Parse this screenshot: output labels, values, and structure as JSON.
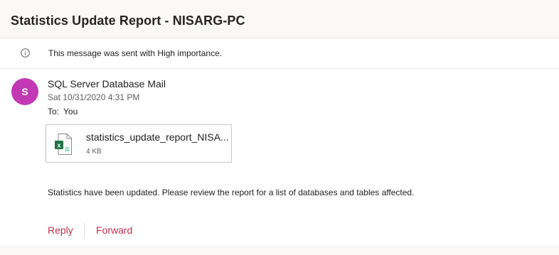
{
  "message": {
    "subject": "Statistics Update Report - NISARG-PC",
    "importance_notice": "This message was sent with High importance.",
    "avatar_initial": "S",
    "sender": "SQL Server Database Mail",
    "date": "Sat 10/31/2020 4:31 PM",
    "to_label": "To:",
    "to_value": "You",
    "body": "Statistics have been updated. Please review the report for a list of databases and tables affected."
  },
  "attachment": {
    "name": "statistics_update_report_NISA...",
    "size": "4 KB",
    "icon": "excel-file-icon"
  },
  "actions": {
    "reply": "Reply",
    "forward": "Forward"
  },
  "colors": {
    "avatar": "#c239b3",
    "action": "#c4314b",
    "excel": "#217346"
  }
}
